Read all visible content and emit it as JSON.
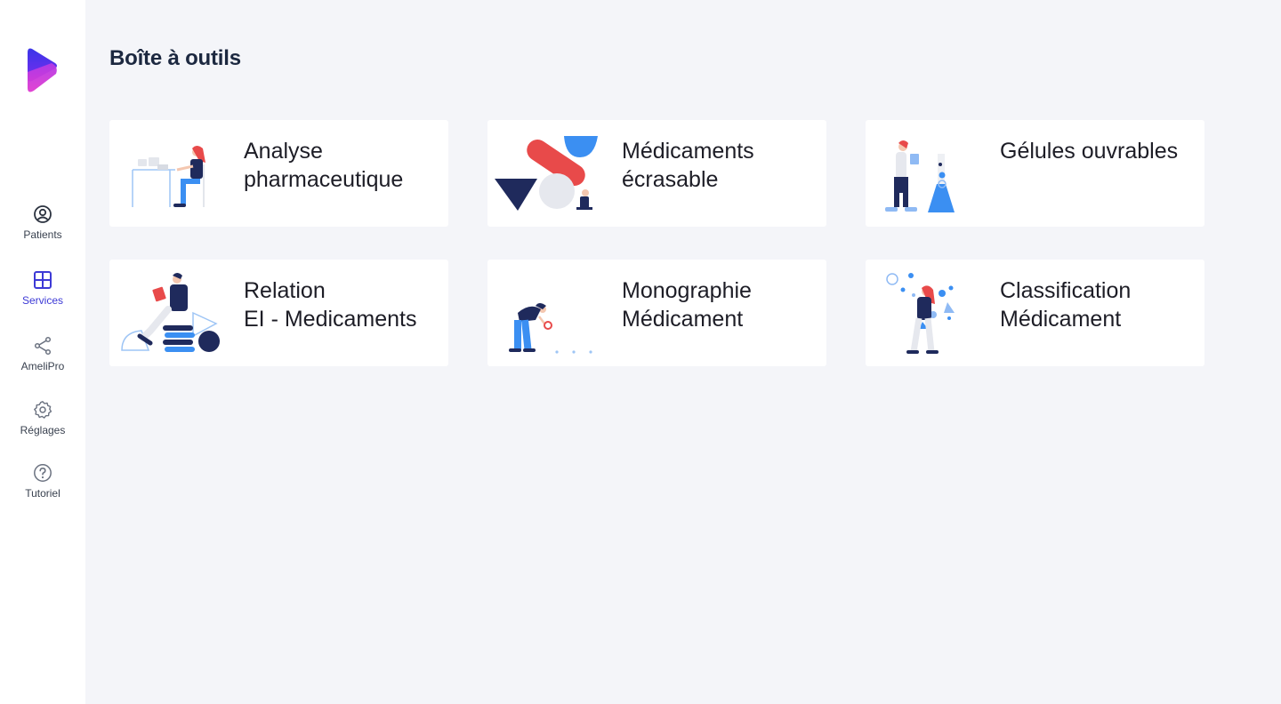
{
  "app": {
    "logo_icon": "brand-play-logo",
    "colors": {
      "accent": "#3d3ad6",
      "brand_purple": "#8b2bf1",
      "brand_magenta": "#c83ad8",
      "navy": "#1c2840",
      "red": "#e84a4a",
      "blue": "#3b8ff2"
    }
  },
  "sidebar": {
    "items": [
      {
        "label": "Patients",
        "icon": "user-circle-icon",
        "active": false
      },
      {
        "label": "Services",
        "icon": "grid-icon",
        "active": true
      },
      {
        "label": "AmeliPro",
        "icon": "share-icon",
        "active": false
      },
      {
        "label": "Réglages",
        "icon": "gear-icon",
        "active": false
      },
      {
        "label": "Tutoriel",
        "icon": "help-circle-icon",
        "active": false
      }
    ]
  },
  "page": {
    "title": "Boîte à outils"
  },
  "cards": [
    {
      "line1": "Analyse",
      "line2": "pharmaceutique",
      "illustration": "person-at-desk-illustration"
    },
    {
      "line1": "Médicaments",
      "line2": "écrasable",
      "illustration": "pill-shapes-illustration"
    },
    {
      "line1": "Gélules ouvrables",
      "line2": "",
      "illustration": "lab-flask-illustration"
    },
    {
      "line1": "Relation",
      "line2": "EI - Medicaments",
      "illustration": "reader-on-books-illustration"
    },
    {
      "line1": "Monographie",
      "line2": "Médicament",
      "illustration": "magnifier-person-illustration"
    },
    {
      "line1": "Classification",
      "line2": "Médicament",
      "illustration": "molecules-person-illustration"
    }
  ]
}
